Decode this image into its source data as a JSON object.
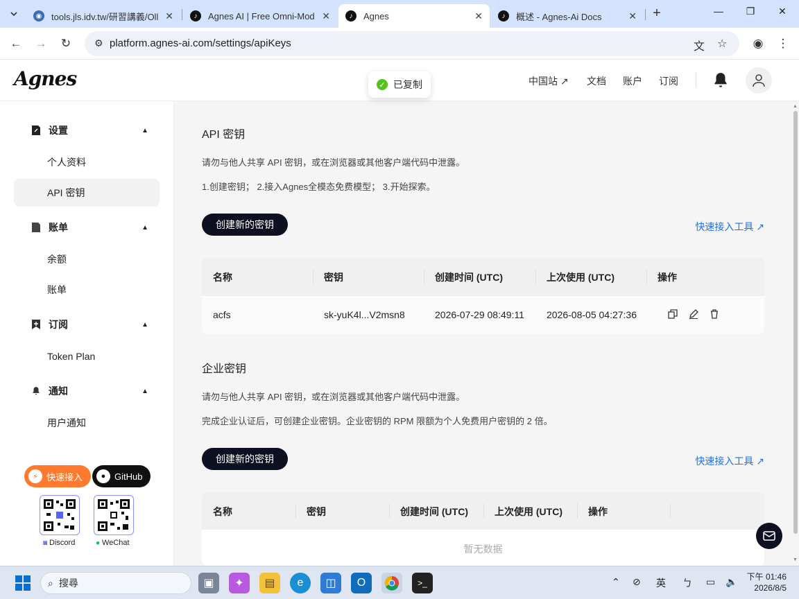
{
  "browser": {
    "tabs": [
      {
        "title": "tools.jls.idv.tw/研習講義/Oll",
        "active": false
      },
      {
        "title": "Agnes AI | Free Omni-Mod",
        "active": false
      },
      {
        "title": "Agnes",
        "active": true
      },
      {
        "title": "概述 - Agnes-Ai Docs",
        "active": false
      }
    ],
    "url": "platform.agnes-ai.com/settings/apiKeys"
  },
  "header": {
    "logo": "Agnes",
    "nav": [
      "中国站 ↗",
      "文档",
      "账户",
      "订阅"
    ]
  },
  "toast": {
    "text": "已复制"
  },
  "sidebar": {
    "groups": [
      {
        "label": "设置",
        "items": [
          "个人资料",
          "API 密钥"
        ]
      },
      {
        "label": "账单",
        "items": [
          "余额",
          "账单"
        ]
      },
      {
        "label": "订阅",
        "items": [
          "Token Plan"
        ]
      },
      {
        "label": "通知",
        "items": [
          "用户通知"
        ]
      }
    ],
    "quick_access": "快速接入",
    "github": "GitHub",
    "discord": "Discord",
    "wechat": "WeChat"
  },
  "api_section": {
    "title": "API 密钥",
    "desc1": "请勿与他人共享 API 密钥，或在浏览器或其他客户端代码中泄露。",
    "desc2": "1.创建密钥； 2.接入Agnes全模态免费模型； 3.开始探索。",
    "create_button": "创建新的密钥",
    "quick_link": "快速接入工具 ↗",
    "columns": [
      "名称",
      "密钥",
      "创建时间 (UTC)",
      "上次使用 (UTC)",
      "操作"
    ],
    "rows": [
      {
        "name": "acfs",
        "key": "sk-yuK4l...V2msn8",
        "created": "2026-07-29 08:49:11",
        "last_used": "2026-08-05 04:27:36"
      }
    ]
  },
  "enterprise_section": {
    "title": "企业密钥",
    "desc1": "请勿与他人共享 API 密钥，或在浏览器或其他客户端代码中泄露。",
    "desc2": "完成企业认证后，可创建企业密钥。企业密钥的 RPM 限额为个人免费用户密钥的 2 倍。",
    "create_button": "创建新的密钥",
    "quick_link": "快速接入工具 ↗",
    "columns": [
      "名称",
      "密钥",
      "创建时间 (UTC)",
      "上次使用 (UTC)",
      "操作"
    ],
    "empty": "暂无数据"
  },
  "taskbar": {
    "search": "搜尋",
    "ime": "英",
    "time": "下午 01:46",
    "date": "2026/8/5"
  },
  "colors": {
    "accent_orange": "#ff7a2f",
    "success": "#52c41a",
    "dark": "#0c1021",
    "link": "#1a73e8"
  }
}
